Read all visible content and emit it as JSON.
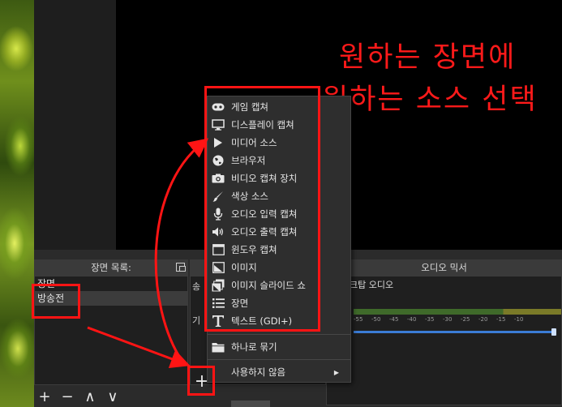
{
  "overlay": {
    "line1": "원하는 장면에",
    "line2": "원하는 소스 선택"
  },
  "scenes_dock": {
    "title": "장면 목록:",
    "items": [
      {
        "label": "장면",
        "selected": false
      },
      {
        "label": "방송전",
        "selected": true
      }
    ],
    "toolbar": {
      "add": "+",
      "remove": "−",
      "up": "∧",
      "down": "∨"
    }
  },
  "sources_dock": {
    "fragments": [
      "송",
      "기"
    ],
    "add": "+"
  },
  "audio_dock": {
    "title": "오디오 믹서",
    "channel_label": "크탑 오디오",
    "ticks": [
      "-55",
      "-50",
      "-45",
      "-40",
      "-35",
      "-30",
      "-25",
      "-20",
      "-15",
      "-10"
    ]
  },
  "context_menu": {
    "items": [
      {
        "label": "게임 캡쳐",
        "icon": "gamepad-icon"
      },
      {
        "label": "디스플레이 캡쳐",
        "icon": "monitor-icon"
      },
      {
        "label": "미디어 소스",
        "icon": "play-icon"
      },
      {
        "label": "브라우저",
        "icon": "globe-icon"
      },
      {
        "label": "비디오 캡쳐 장치",
        "icon": "camera-icon"
      },
      {
        "label": "색상 소스",
        "icon": "brush-icon"
      },
      {
        "label": "오디오 입력 캡쳐",
        "icon": "microphone-icon"
      },
      {
        "label": "오디오 출력 캡쳐",
        "icon": "speaker-icon"
      },
      {
        "label": "윈도우 캡쳐",
        "icon": "window-icon"
      },
      {
        "label": "이미지",
        "icon": "image-icon"
      },
      {
        "label": "이미지 슬라이드 쇼",
        "icon": "slideshow-icon"
      },
      {
        "label": "장면",
        "icon": "list-icon"
      },
      {
        "label": "텍스트 (GDI+)",
        "icon": "text-icon"
      }
    ],
    "group": {
      "label": "하나로 묶기",
      "icon": "folder-icon"
    },
    "deprecated": {
      "label": "사용하지 않음",
      "arrow": "▶"
    }
  },
  "colors": {
    "highlight": "#ff1414",
    "menu_bg": "#2e2e2e",
    "preview_bg": "#000000"
  }
}
